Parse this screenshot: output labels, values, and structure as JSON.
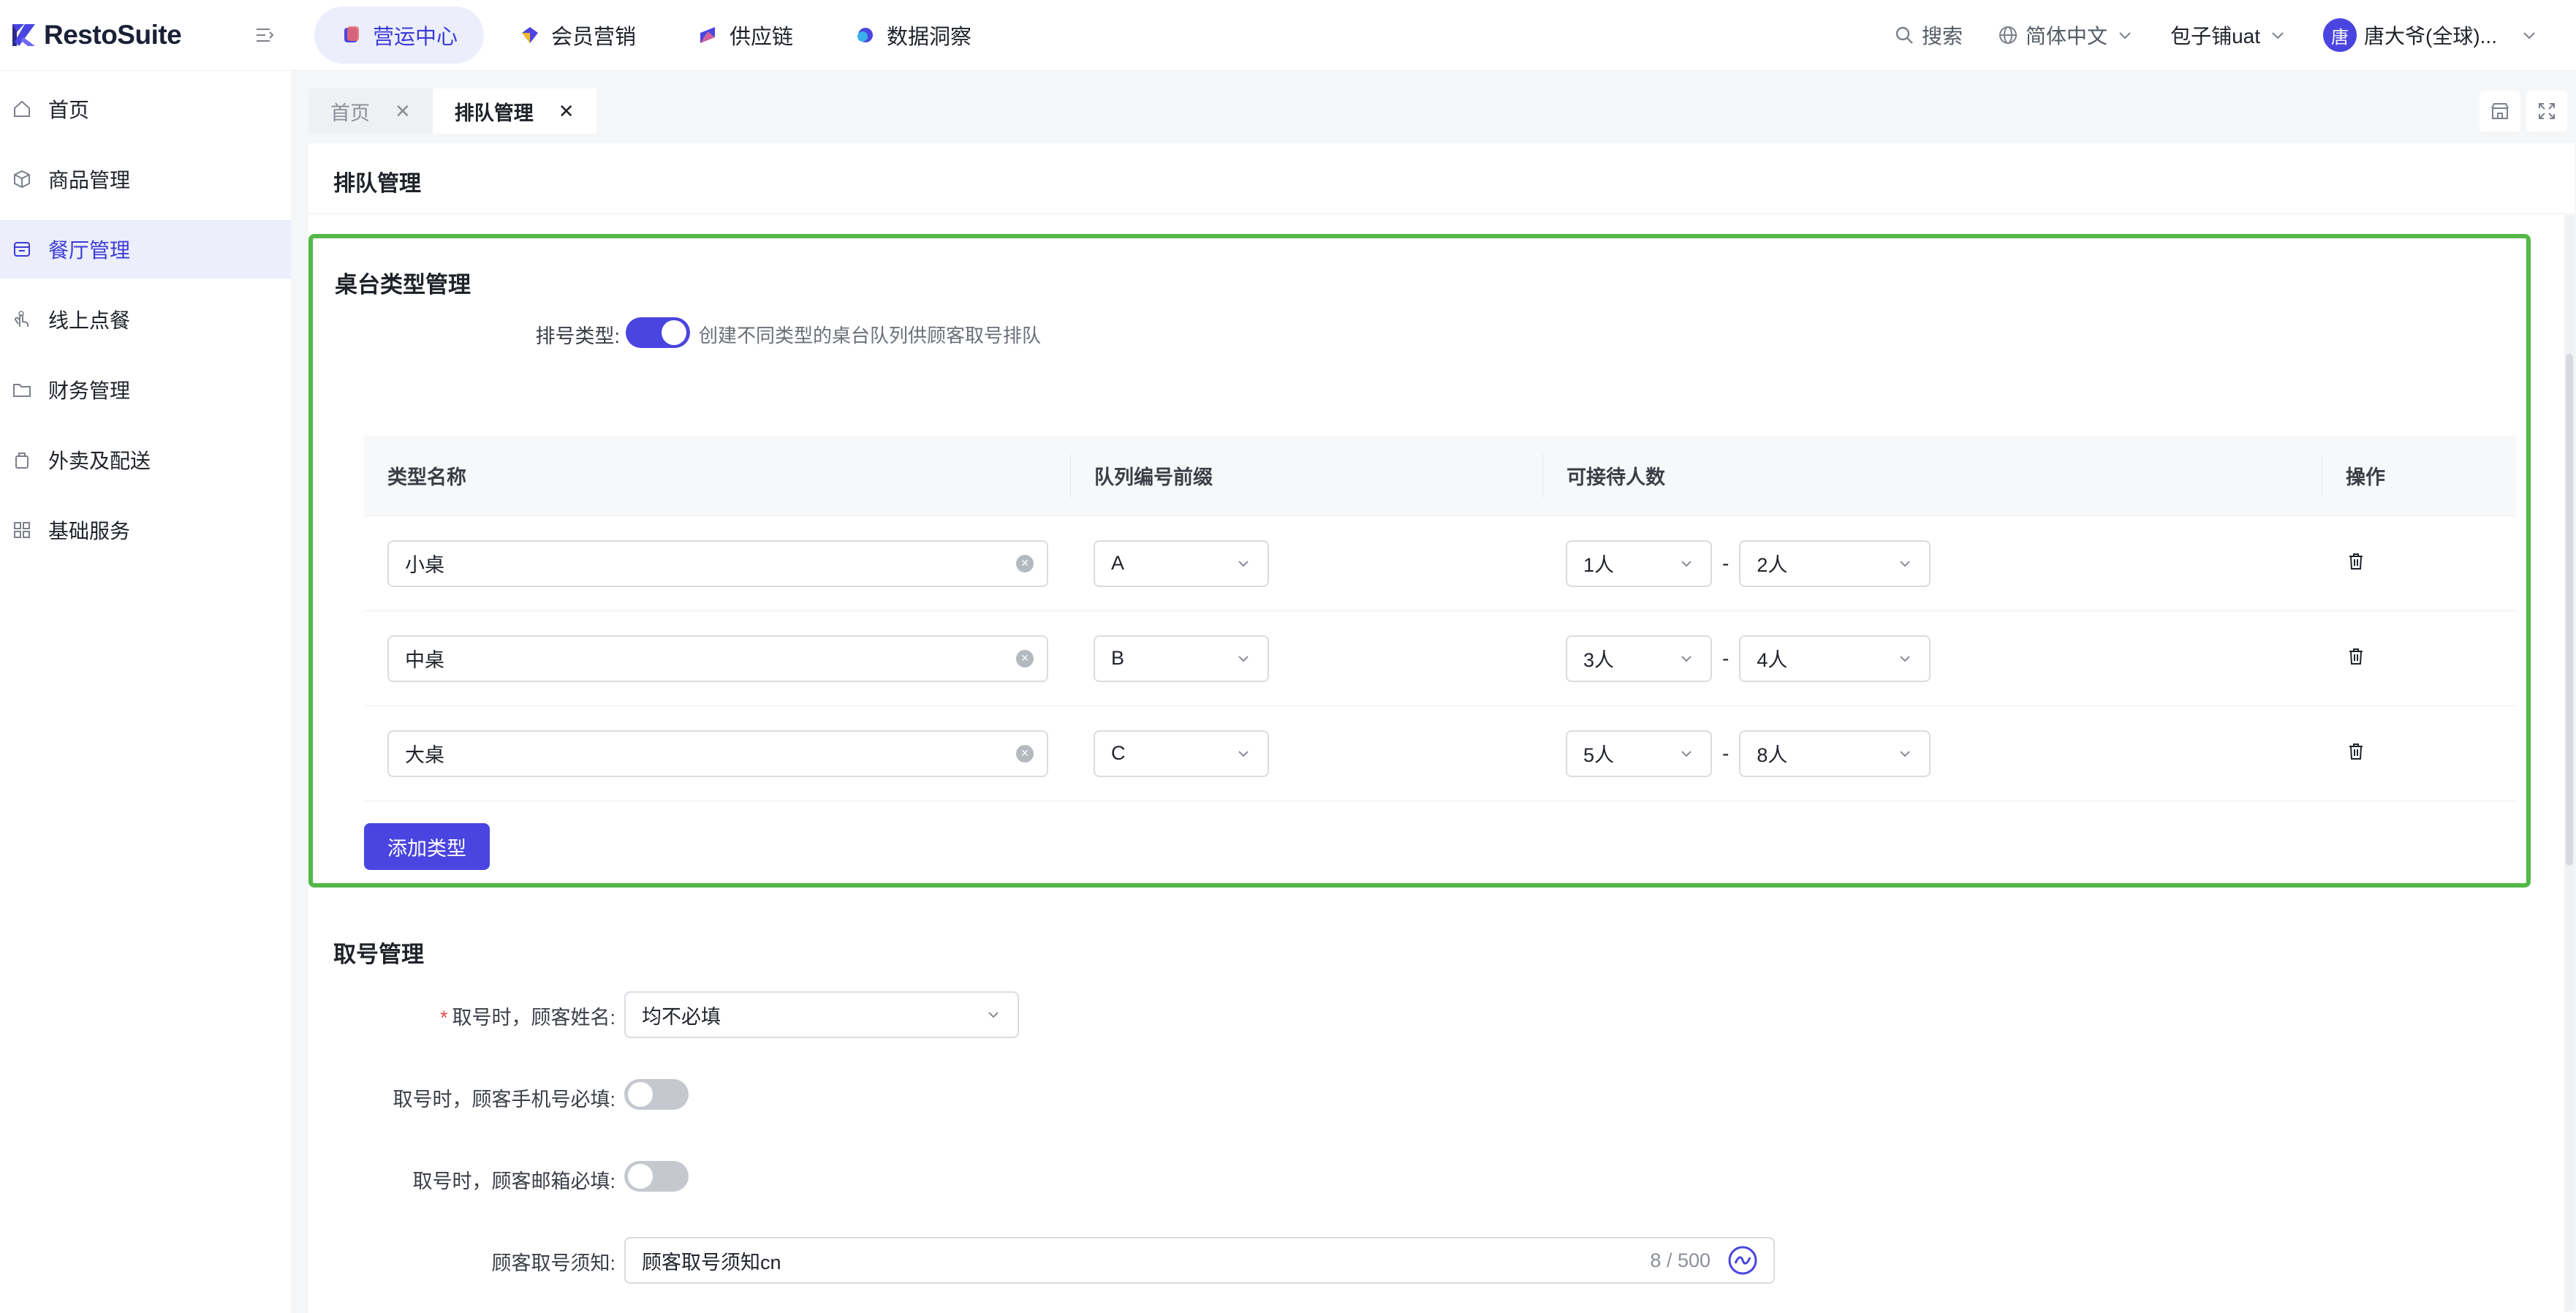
{
  "app": {
    "logo_text": "RestoSuite"
  },
  "topnav": [
    {
      "label": "营运中心",
      "active": true,
      "icon": "operations-icon"
    },
    {
      "label": "会员营销",
      "active": false,
      "icon": "membership-icon"
    },
    {
      "label": "供应链",
      "active": false,
      "icon": "supply-chain-icon"
    },
    {
      "label": "数据洞察",
      "active": false,
      "icon": "data-insight-icon"
    }
  ],
  "top_right": {
    "search": "搜索",
    "language": "简体中文",
    "store": "包子铺uat",
    "avatar_initial": "唐",
    "user": "唐大爷(全球)..."
  },
  "sidebar": {
    "items": [
      {
        "label": "首页",
        "icon": "home-icon"
      },
      {
        "label": "商品管理",
        "icon": "product-box-icon"
      },
      {
        "label": "餐厅管理",
        "icon": "restaurant-icon",
        "active": true
      },
      {
        "label": "线上点餐",
        "icon": "hand-tap-icon"
      },
      {
        "label": "财务管理",
        "icon": "folder-icon"
      },
      {
        "label": "外卖及配送",
        "icon": "delivery-bag-icon"
      },
      {
        "label": "基础服务",
        "icon": "grid-apps-icon"
      }
    ]
  },
  "tabs": [
    {
      "label": "首页",
      "active": false
    },
    {
      "label": "排队管理",
      "active": true
    }
  ],
  "page": {
    "title": "排队管理"
  },
  "table_types": {
    "title": "桌台类型管理",
    "switch_label": "排号类型:",
    "switch_on": true,
    "switch_hint": "创建不同类型的桌台队列供顾客取号排队",
    "columns": [
      "类型名称",
      "队列编号前缀",
      "可接待人数",
      "操作"
    ],
    "rows": [
      {
        "name": "小桌",
        "prefix": "A",
        "min": "1人",
        "max": "2人"
      },
      {
        "name": "中桌",
        "prefix": "B",
        "min": "3人",
        "max": "4人"
      },
      {
        "name": "大桌",
        "prefix": "C",
        "min": "5人",
        "max": "8人"
      }
    ],
    "range_sep": "-",
    "add_button": "添加类型"
  },
  "ticket": {
    "title": "取号管理",
    "name_label": "取号时，顾客姓名:",
    "name_required_mark": "*",
    "name_value": "均不必填",
    "phone_label": "取号时，顾客手机号必填:",
    "phone_on": false,
    "email_label": "取号时，顾客邮箱必填:",
    "email_on": false,
    "notice_label": "顾客取号须知:",
    "notice_value": "顾客取号须知cn",
    "notice_count": "8 / 500"
  },
  "colors": {
    "accent": "#4a45e0",
    "highlight_border": "#53b848"
  }
}
